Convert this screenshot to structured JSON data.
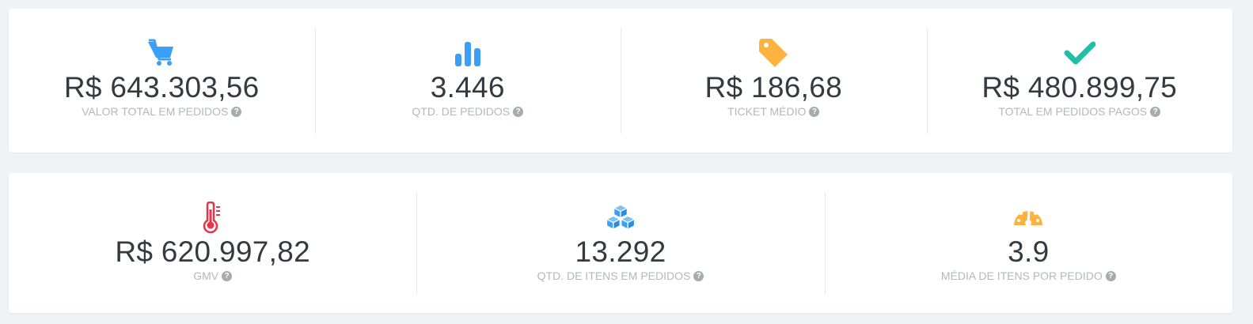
{
  "row1": [
    {
      "icon": "shopping-cart-icon",
      "icon_color": "#3ba0f5",
      "value": "R$ 643.303,56",
      "label": "VALOR TOTAL EM PEDIDOS",
      "help": "?"
    },
    {
      "icon": "bar-chart-icon",
      "icon_color": "#3ba0f5",
      "value": "3.446",
      "label": "QTD. DE PEDIDOS",
      "help": "?"
    },
    {
      "icon": "price-tag-icon",
      "icon_color": "#ffb23e",
      "value": "R$ 186,68",
      "label": "TICKET MÉDIO",
      "help": "?"
    },
    {
      "icon": "checkmark-icon",
      "icon_color": "#21bfa5",
      "value": "R$ 480.899,75",
      "label": "TOTAL EM PEDIDOS PAGOS",
      "help": "?"
    }
  ],
  "row2": [
    {
      "icon": "thermometer-icon",
      "icon_color": "#e8344a",
      "value": "R$ 620.997,82",
      "label": "GMV",
      "help": "?"
    },
    {
      "icon": "cubes-icon",
      "icon_color": "#3ba0f5",
      "value": "13.292",
      "label": "QTD. DE ITENS EM PEDIDOS",
      "help": "?"
    },
    {
      "icon": "speedometer-icon",
      "icon_color": "#ffb23e",
      "value": "3.9",
      "label": "MÉDIA DE ITENS POR PEDIDO",
      "help": "?"
    }
  ]
}
